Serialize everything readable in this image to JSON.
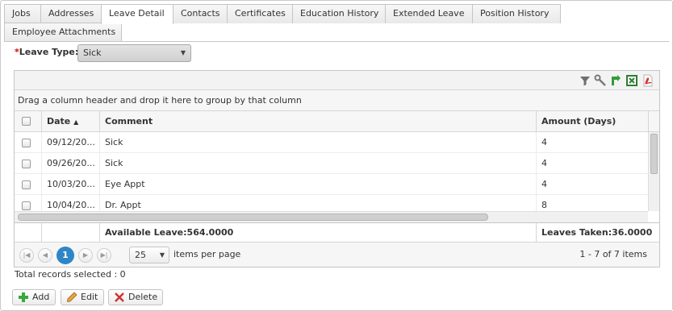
{
  "tabs": [
    {
      "label": "Jobs"
    },
    {
      "label": "Addresses"
    },
    {
      "label": "Leave Detail"
    },
    {
      "label": "Contacts"
    },
    {
      "label": "Certificates"
    },
    {
      "label": "Education History"
    },
    {
      "label": "Extended Leave"
    },
    {
      "label": "Position History"
    },
    {
      "label": "Employee Attachments"
    }
  ],
  "active_tab": "Leave Detail",
  "leave_type": {
    "required_mark": "*",
    "label": "Leave Type:",
    "value": "Sick"
  },
  "toolbar": {
    "icons": [
      "filter-icon",
      "wrench-icon",
      "refresh-icon",
      "excel-export-icon",
      "pdf-export-icon"
    ]
  },
  "grid": {
    "group_hint": "Drag a column header and drop it here to group by that column",
    "columns": {
      "date": "Date",
      "sort_indicator": "▲",
      "comment": "Comment",
      "amount": "Amount (Days)"
    },
    "rows": [
      {
        "date": "09/12/20...",
        "comment": "Sick",
        "amount": "4"
      },
      {
        "date": "09/26/20...",
        "comment": "Sick",
        "amount": "4"
      },
      {
        "date": "10/03/20...",
        "comment": "Eye Appt",
        "amount": "4"
      },
      {
        "date": "10/04/20...",
        "comment": "Dr. Appt",
        "amount": "8"
      }
    ],
    "footer": {
      "available": "Available Leave:564.0000",
      "taken": "Leaves Taken:36.0000"
    }
  },
  "pager": {
    "current_page": "1",
    "page_size": "25",
    "items_per_page_label": "items per page",
    "info": "1 - 7 of 7 items"
  },
  "total_selected": "Total records selected : 0",
  "actions": {
    "add": "Add",
    "edit": "Edit",
    "delete": "Delete"
  },
  "colors": {
    "accent": "#2f86c6",
    "border": "#c5c5c5"
  }
}
